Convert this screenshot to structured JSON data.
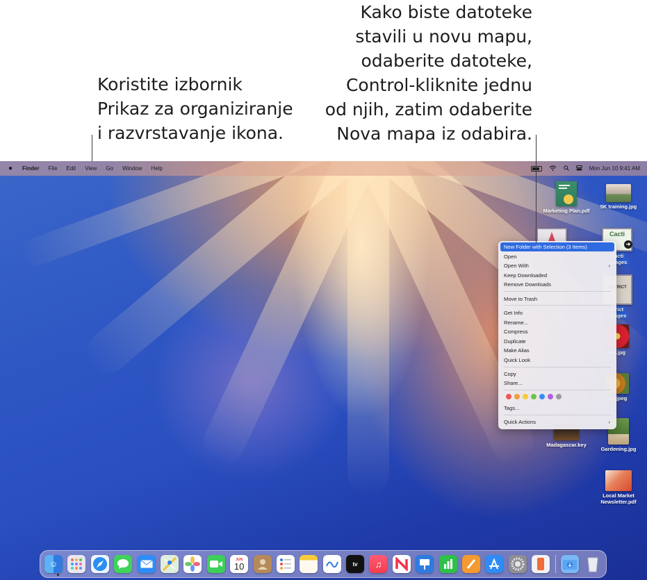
{
  "callouts": {
    "left": "Koristite izbornik\nPrikaz za organiziranje\ni razvrstavanje ikona.",
    "right": "Kako biste datoteke\nstavili u novu mapu,\nodaberite datoteke,\nControl-kliknite jednu\nod njih, zatim odaberite\nNova mapa iz odabira."
  },
  "menubar": {
    "apple": "",
    "items": [
      "Finder",
      "File",
      "Edit",
      "View",
      "Go",
      "Window",
      "Help"
    ],
    "clock": "Mon Jun 10  9:41 AM"
  },
  "desktop": {
    "files": [
      "Marketing Plan.pdf",
      "5K training.jpg",
      "Cacti",
      "n.pages",
      "strict",
      "t.pages",
      "ver.jpg",
      "ers.jpeg",
      "Madagascar.key",
      "Gardening.jpg",
      "Local Market\nNewsletter.pdf"
    ],
    "thumb_texts": [
      "Cacti",
      "DISTRICT"
    ]
  },
  "context_menu": {
    "items": [
      "New Folder with Selection (3 Items)",
      "Open",
      "Open With",
      "Keep Downloaded",
      "Remove Downloads",
      "Move to Trash",
      "Get Info",
      "Rename...",
      "Compress",
      "Duplicate",
      "Make Alias",
      "Quick Look",
      "Copy",
      "Share...",
      "Tags...",
      "Quick Actions"
    ],
    "tag_colors": [
      "#ee5a52",
      "#f39c3c",
      "#f5cc3c",
      "#6cc24a",
      "#3d8bf0",
      "#b45ee0",
      "#9a9a9e"
    ]
  },
  "dock": {
    "calendar_month": "JUN",
    "calendar_day": "10",
    "tv_label": "tv",
    "apps": [
      "finder-icon",
      "launchpad-icon",
      "safari-icon",
      "messages-icon",
      "mail-icon",
      "maps-icon",
      "photos-icon",
      "facetime-icon",
      "calendar-icon",
      "contacts-icon",
      "reminders-icon",
      "notes-icon",
      "freeform-icon",
      "tv-icon",
      "music-icon",
      "news-icon",
      "keynote-icon",
      "numbers-icon",
      "pages-icon",
      "app-store-icon",
      "system-settings-icon",
      "iphone-mirroring-icon",
      "downloads-folder-icon",
      "trash-icon"
    ]
  }
}
